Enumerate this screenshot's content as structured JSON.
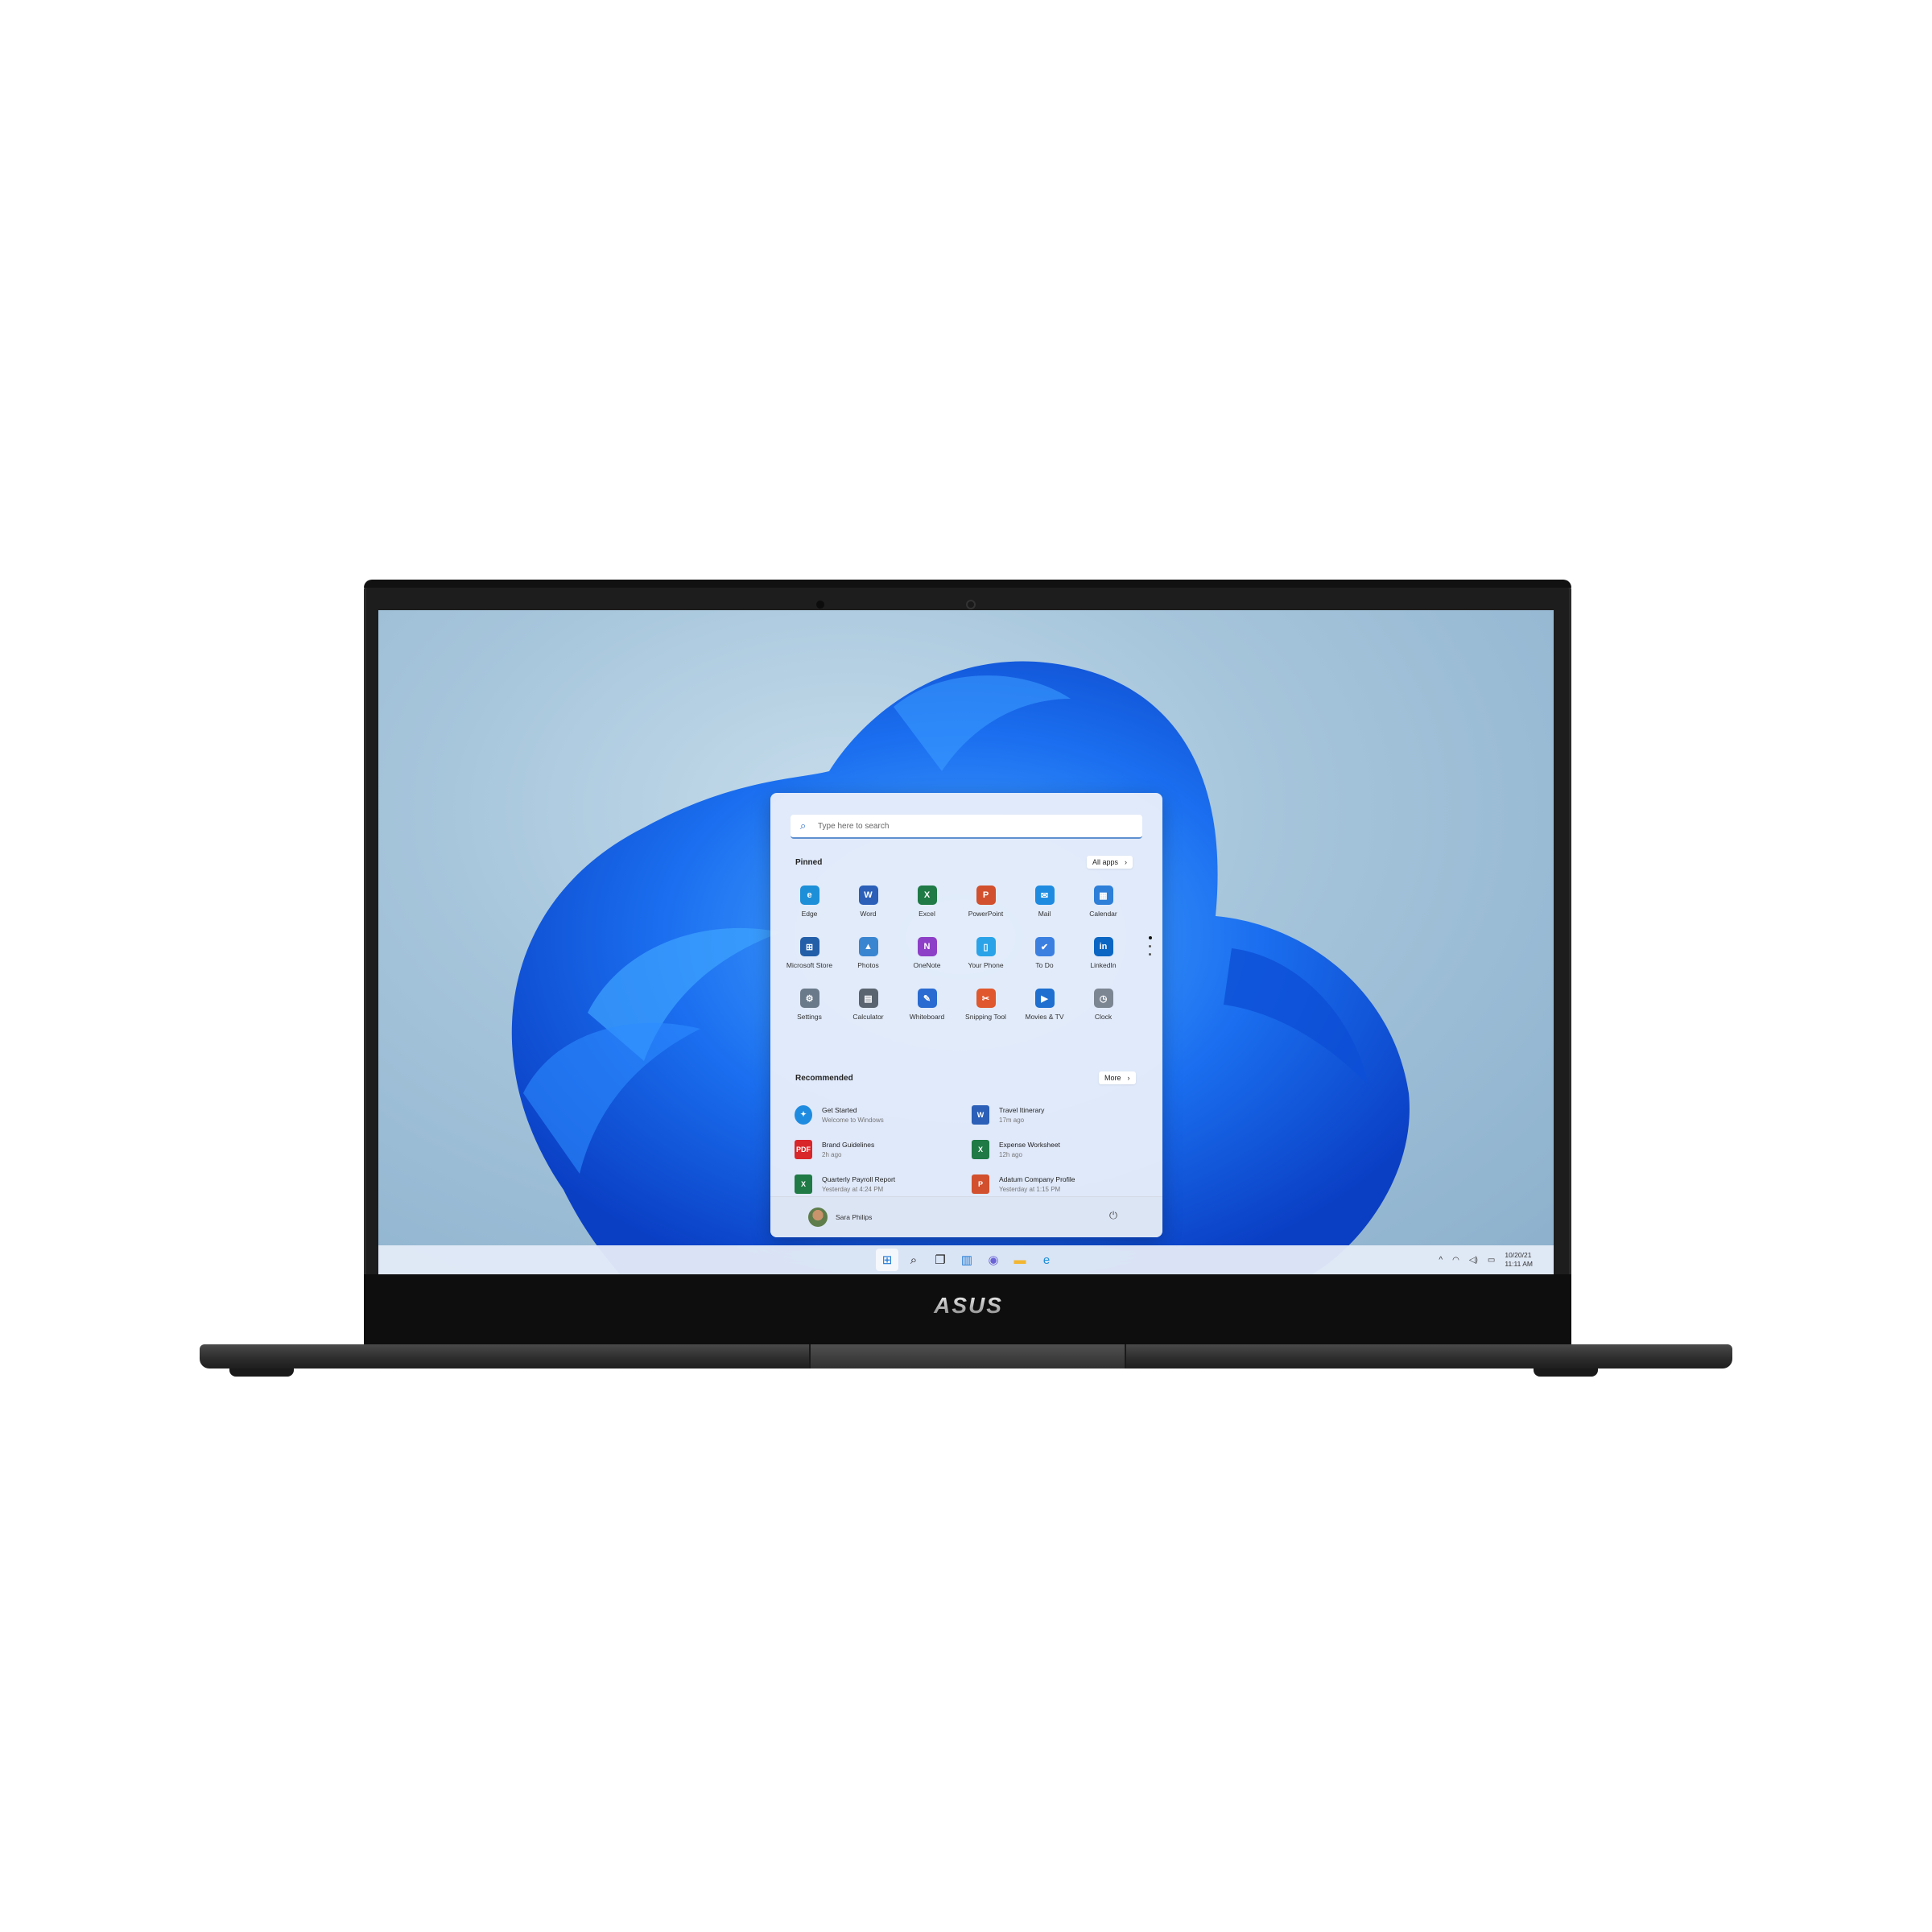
{
  "device": {
    "brand": "ASUS"
  },
  "start_menu": {
    "search": {
      "placeholder": "Type here to search"
    },
    "pinned": {
      "title": "Pinned",
      "all_apps_label": "All apps",
      "apps": [
        {
          "label": "Edge",
          "icon": "edge-icon",
          "color": "#1d8fd8",
          "glyph": "e"
        },
        {
          "label": "Word",
          "icon": "word-icon",
          "color": "#2b5fb8",
          "glyph": "W"
        },
        {
          "label": "Excel",
          "icon": "excel-icon",
          "color": "#1f7a45",
          "glyph": "X"
        },
        {
          "label": "PowerPoint",
          "icon": "powerpoint-icon",
          "color": "#d2502d",
          "glyph": "P"
        },
        {
          "label": "Mail",
          "icon": "mail-icon",
          "color": "#1f8be0",
          "glyph": "✉"
        },
        {
          "label": "Calendar",
          "icon": "calendar-icon",
          "color": "#2d7fd8",
          "glyph": "▦"
        },
        {
          "label": "Microsoft Store",
          "icon": "store-icon",
          "color": "#235ea8",
          "glyph": "⊞"
        },
        {
          "label": "Photos",
          "icon": "photos-icon",
          "color": "#3a85d0",
          "glyph": "▲"
        },
        {
          "label": "OneNote",
          "icon": "onenote-icon",
          "color": "#8e3fc7",
          "glyph": "N"
        },
        {
          "label": "Your Phone",
          "icon": "phone-icon",
          "color": "#2aa3e8",
          "glyph": "▯"
        },
        {
          "label": "To Do",
          "icon": "todo-icon",
          "color": "#3b7fe0",
          "glyph": "✔"
        },
        {
          "label": "LinkedIn",
          "icon": "linkedin-icon",
          "color": "#0a66c2",
          "glyph": "in"
        },
        {
          "label": "Settings",
          "icon": "settings-icon",
          "color": "#6b7a8a",
          "glyph": "⚙"
        },
        {
          "label": "Calculator",
          "icon": "calculator-icon",
          "color": "#5a6470",
          "glyph": "▤"
        },
        {
          "label": "Whiteboard",
          "icon": "whiteboard-icon",
          "color": "#2a6bd1",
          "glyph": "✎"
        },
        {
          "label": "Snipping Tool",
          "icon": "snipping-tool-icon",
          "color": "#e0582d",
          "glyph": "✂"
        },
        {
          "label": "Movies & TV",
          "icon": "movies-icon",
          "color": "#1e6fcf",
          "glyph": "▶"
        },
        {
          "label": "Clock",
          "icon": "clock-icon",
          "color": "#7c8693",
          "glyph": "◷"
        }
      ],
      "page_count": 3,
      "current_page": 1
    },
    "recommended": {
      "title": "Recommended",
      "more_label": "More",
      "items": [
        {
          "title": "Get Started",
          "subtitle": "Welcome to Windows",
          "icon": "get-started-icon",
          "color": "#1f8be0",
          "glyph": "✦"
        },
        {
          "title": "Travel Itinerary",
          "subtitle": "17m ago",
          "icon": "word-doc-icon",
          "color": "#2b5fb8",
          "glyph": "W"
        },
        {
          "title": "Brand Guidelines",
          "subtitle": "2h ago",
          "icon": "pdf-icon",
          "color": "#d9262b",
          "glyph": "PDF"
        },
        {
          "title": "Expense Worksheet",
          "subtitle": "12h ago",
          "icon": "excel-doc-icon",
          "color": "#1f7a45",
          "glyph": "X"
        },
        {
          "title": "Quarterly Payroll Report",
          "subtitle": "Yesterday at 4:24 PM",
          "icon": "excel-doc-icon",
          "color": "#1f7a45",
          "glyph": "X"
        },
        {
          "title": "Adatum Company Profile",
          "subtitle": "Yesterday at 1:15 PM",
          "icon": "powerpoint-doc-icon",
          "color": "#d2502d",
          "glyph": "P"
        }
      ]
    },
    "user": {
      "name": "Sara Philips"
    },
    "power_icon": "power-icon"
  },
  "taskbar": {
    "icons": [
      {
        "name": "start-button",
        "glyph": "⊞",
        "color": "#1e78d4",
        "active": true
      },
      {
        "name": "search-button",
        "glyph": "⌕",
        "color": "#222"
      },
      {
        "name": "task-view-button",
        "glyph": "❐",
        "color": "#222"
      },
      {
        "name": "widgets-button",
        "glyph": "▥",
        "color": "#1e78d4"
      },
      {
        "name": "chat-button",
        "glyph": "◉",
        "color": "#6b63d6"
      },
      {
        "name": "file-explorer-button",
        "glyph": "▬",
        "color": "#f2b632"
      },
      {
        "name": "edge-button",
        "glyph": "e",
        "color": "#1d8fd8"
      }
    ],
    "tray": {
      "chevron": "^",
      "wifi": "◠",
      "volume": "◁)",
      "battery": "▭"
    },
    "date": "10/20/21",
    "time": "11:11 AM"
  }
}
